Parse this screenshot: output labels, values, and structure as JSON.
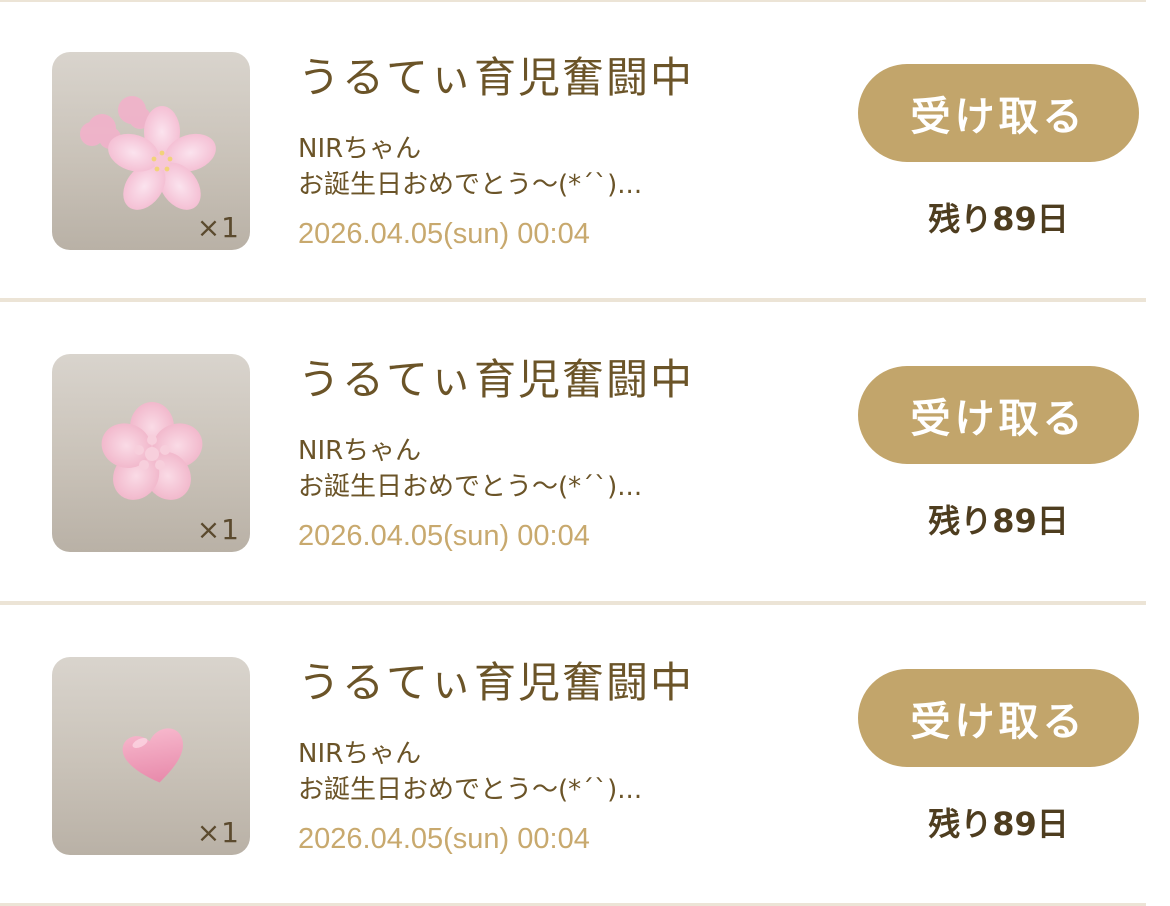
{
  "items": [
    {
      "gift_icon": "sakura-bouquet-icon",
      "quantity": "×1",
      "title": "うるてぃ育児奮闘中",
      "sender": "NIRちゃん",
      "message": "お誕生日おめでとう〜(*´`)...",
      "date": "2026.04.05(sun) 00:04",
      "button_label": "受け取る",
      "remaining": "残り89日"
    },
    {
      "gift_icon": "sakura-flower-icon",
      "quantity": "×1",
      "title": "うるてぃ育児奮闘中",
      "sender": "NIRちゃん",
      "message": "お誕生日おめでとう〜(*´`)...",
      "date": "2026.04.05(sun) 00:04",
      "button_label": "受け取る",
      "remaining": "残り89日"
    },
    {
      "gift_icon": "pink-heart-icon",
      "quantity": "×1",
      "title": "うるてぃ育児奮闘中",
      "sender": "NIRちゃん",
      "message": "お誕生日おめでとう〜(*´`)...",
      "date": "2026.04.05(sun) 00:04",
      "button_label": "受け取る",
      "remaining": "残り89日"
    }
  ],
  "colors": {
    "accent_gold": "#c2a56b",
    "date_gold": "#c8a96e",
    "text_brown": "#6b5428",
    "divider": "#ece4d6"
  }
}
